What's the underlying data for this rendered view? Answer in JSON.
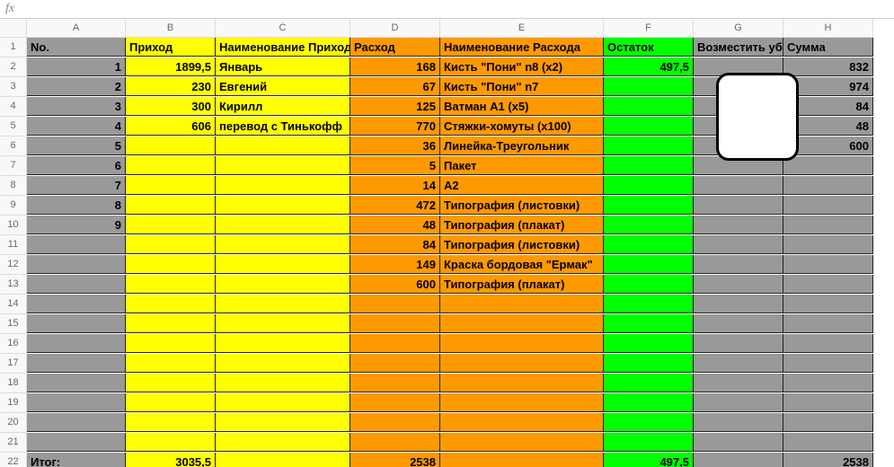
{
  "formula_bar": {
    "fx": "fx"
  },
  "columns": [
    "A",
    "B",
    "C",
    "D",
    "E",
    "F",
    "G",
    "H"
  ],
  "row_numbers": [
    "1",
    "2",
    "3",
    "4",
    "5",
    "6",
    "7",
    "8",
    "9",
    "10",
    "11",
    "12",
    "13",
    "14",
    "15",
    "16",
    "17",
    "18",
    "19",
    "20",
    "21",
    "22"
  ],
  "header": {
    "A": "No.",
    "B": "Приход",
    "C": "Наименование Прихода",
    "D": "Расход",
    "E": "Наименование Расхода",
    "F": "Остаток",
    "G": "Возместить убытки",
    "H": "Сумма"
  },
  "rows": [
    {
      "A": "1",
      "B": "1899,5",
      "C": "Январь",
      "D": "168",
      "E": "Кисть \"Пони\" n8 (x2)",
      "F": "497,5",
      "G": "",
      "H": "832"
    },
    {
      "A": "2",
      "B": "230",
      "C": "Евгений",
      "D": "67",
      "E": "Кисть \"Пони\" n7",
      "F": "",
      "G": "",
      "H": "974"
    },
    {
      "A": "3",
      "B": "300",
      "C": "Кирилл",
      "D": "125",
      "E": "Ватман А1 (x5)",
      "F": "",
      "G": "",
      "H": "84"
    },
    {
      "A": "4",
      "B": "606",
      "C": "перевод с Тинькофф",
      "D": "770",
      "E": "Стяжки-хомуты (x100)",
      "F": "",
      "G": "",
      "H": "48"
    },
    {
      "A": "5",
      "B": "",
      "C": "",
      "D": "36",
      "E": "Линейка-Треугольник",
      "F": "",
      "G": "",
      "H": "600"
    },
    {
      "A": "6",
      "B": "",
      "C": "",
      "D": "5",
      "E": "Пакет",
      "F": "",
      "G": "",
      "H": ""
    },
    {
      "A": "7",
      "B": "",
      "C": "",
      "D": "14",
      "E": "А2",
      "F": "",
      "G": "",
      "H": ""
    },
    {
      "A": "8",
      "B": "",
      "C": "",
      "D": "472",
      "E": "Типография (листовки)",
      "F": "",
      "G": "",
      "H": ""
    },
    {
      "A": "9",
      "B": "",
      "C": "",
      "D": "48",
      "E": "Типография (плакат)",
      "F": "",
      "G": "",
      "H": ""
    },
    {
      "A": "",
      "B": "",
      "C": "",
      "D": "84",
      "E": "Типография (листовки)",
      "F": "",
      "G": "",
      "H": ""
    },
    {
      "A": "",
      "B": "",
      "C": "",
      "D": "149",
      "E": "Краска бордовая \"Ермак\"",
      "F": "",
      "G": "",
      "H": ""
    },
    {
      "A": "",
      "B": "",
      "C": "",
      "D": "600",
      "E": "Типография (плакат)",
      "F": "",
      "G": "",
      "H": ""
    },
    {
      "A": "",
      "B": "",
      "C": "",
      "D": "",
      "E": "",
      "F": "",
      "G": "",
      "H": ""
    },
    {
      "A": "",
      "B": "",
      "C": "",
      "D": "",
      "E": "",
      "F": "",
      "G": "",
      "H": ""
    },
    {
      "A": "",
      "B": "",
      "C": "",
      "D": "",
      "E": "",
      "F": "",
      "G": "",
      "H": ""
    },
    {
      "A": "",
      "B": "",
      "C": "",
      "D": "",
      "E": "",
      "F": "",
      "G": "",
      "H": ""
    },
    {
      "A": "",
      "B": "",
      "C": "",
      "D": "",
      "E": "",
      "F": "",
      "G": "",
      "H": ""
    },
    {
      "A": "",
      "B": "",
      "C": "",
      "D": "",
      "E": "",
      "F": "",
      "G": "",
      "H": ""
    },
    {
      "A": "",
      "B": "",
      "C": "",
      "D": "",
      "E": "",
      "F": "",
      "G": "",
      "H": ""
    },
    {
      "A": "",
      "B": "",
      "C": "",
      "D": "",
      "E": "",
      "F": "",
      "G": "",
      "H": ""
    }
  ],
  "footer": {
    "A": "Итог:",
    "B": "3035,5",
    "C": "",
    "D": "2538",
    "E": "",
    "F": "497,5",
    "G": "",
    "H": "2538"
  },
  "colors": {
    "gray": "#999999",
    "yellow": "#ffff00",
    "orange": "#ff9900",
    "green": "#00ff00"
  }
}
